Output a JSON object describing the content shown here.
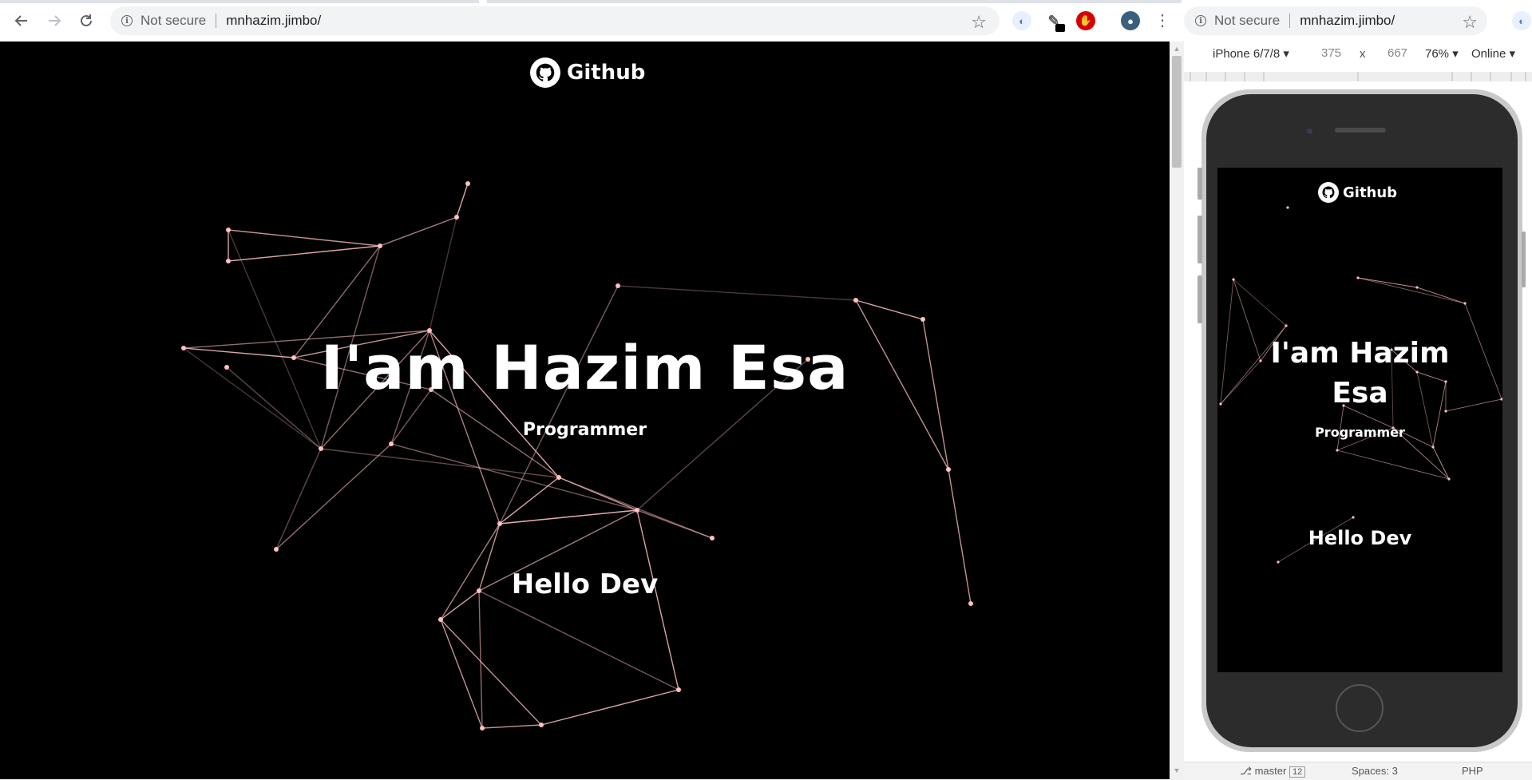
{
  "browser": {
    "url": "mnhazim.jimbo/",
    "security_text": "Not secure",
    "back_icon": "arrow-left-icon",
    "forward_icon": "arrow-right-icon",
    "reload_icon": "reload-icon",
    "bookmark_icon": "star-icon",
    "menu_icon": "kebab-menu-icon"
  },
  "page": {
    "github_label": "Github",
    "headline": "I'am Hazim Esa",
    "subtitle": "Programmer",
    "greeting": "Hello Dev"
  },
  "device_toolbar": {
    "device": "iPhone 6/7/8",
    "width": "375",
    "height": "667",
    "times": "x",
    "zoom": "76%",
    "network": "Online"
  },
  "mobile_page": {
    "github_label": "Github",
    "headline_line1": "I'am Hazim",
    "headline_line2": "Esa",
    "subtitle": "Programmer",
    "greeting": "Hello Dev"
  },
  "status_bar": {
    "branch": "master",
    "branch_count": "12",
    "spaces": "Spaces: 3",
    "language": "PHP"
  },
  "colors": {
    "page_bg": "#000000",
    "network_line": "#f3b6b6",
    "network_node": "#ffc1c1",
    "text": "#ffffff"
  }
}
